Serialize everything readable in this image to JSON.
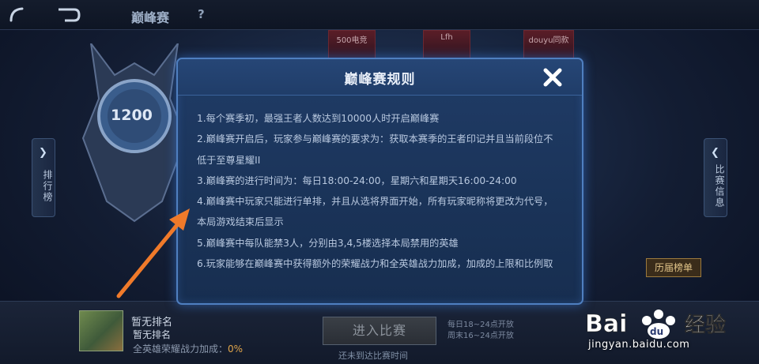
{
  "topbar": {
    "title": "巅峰赛",
    "help": "?"
  },
  "background": {
    "cards": [
      "500电竞",
      "Lfh",
      "douyu同款"
    ],
    "emblem_score": "1200",
    "left_tab": "排行榜",
    "right_tab": "比赛信息",
    "history_label": "历届榜单"
  },
  "bottom": {
    "rank_title": "暂无排名",
    "rank_sub": "暂无排名",
    "power_label": "全英雄荣耀战力加成：",
    "power_value": "0%",
    "enter_button": "进入比赛",
    "not_time": "还未到达比赛时间",
    "open_times": [
      "每日18~24点开放",
      "周末16~24点开放"
    ]
  },
  "modal": {
    "title": "巅峰赛规则",
    "close_icon": "close-icon",
    "rules": [
      "1.每个赛季初，最强王者人数达到10000人时开启巅峰赛",
      "2.巅峰赛开启后，玩家参与巅峰赛的要求为：获取本赛季的王者印记并且当前段位不",
      "低于至尊星耀II",
      "3.巅峰赛的进行时间为：每日18:00-24:00，星期六和星期天16:00-24:00",
      "4.巅峰赛中玩家只能进行单排，并且从选将界面开始，所有玩家昵称将更改为代号，",
      "本局游戏结束后显示",
      "5.巅峰赛中每队能禁3人，分别由3,4,5楼选择本局禁用的英雄",
      "6.玩家能够在巅峰赛中获得额外的荣耀战力和全英雄战力加成，加成的上限和比例取"
    ]
  },
  "watermark": {
    "brand": "Bai度经验",
    "url": "jingyan.baidu.com"
  },
  "colors": {
    "modal_border": "#4f7fc0",
    "arrow": "#f07a2a",
    "power_pct": "#e0a54a"
  }
}
